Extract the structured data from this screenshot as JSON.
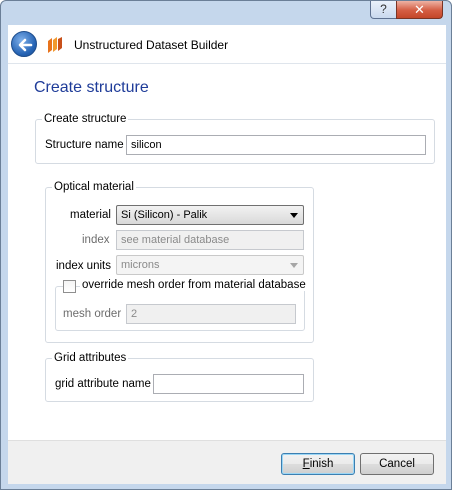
{
  "titlebar": {
    "help_label": "?",
    "close_label": "✕"
  },
  "header": {
    "title": "Unstructured Dataset Builder",
    "back_icon": "back-arrow-icon",
    "app_icon": "lumerical-logo-icon",
    "accent_color": "#2563b4"
  },
  "page": {
    "title": "Create structure"
  },
  "create_structure": {
    "group_title": "Create structure",
    "name_label": "Structure name",
    "name_value": "silicon"
  },
  "optical_material": {
    "group_title": "Optical material",
    "material_label": "material",
    "material_value": "Si (Silicon) - Palik",
    "index_label": "index",
    "index_placeholder": "see material database",
    "index_units_label": "index units",
    "index_units_value": "microns",
    "override_label": "override mesh order from material database",
    "override_checked": false,
    "mesh_order_label": "mesh order",
    "mesh_order_value": "2"
  },
  "grid_attributes": {
    "group_title": "Grid attributes",
    "name_label": "grid attribute name",
    "name_value": ""
  },
  "footer": {
    "finish_first": "F",
    "finish_rest": "inish",
    "cancel_label": "Cancel"
  }
}
